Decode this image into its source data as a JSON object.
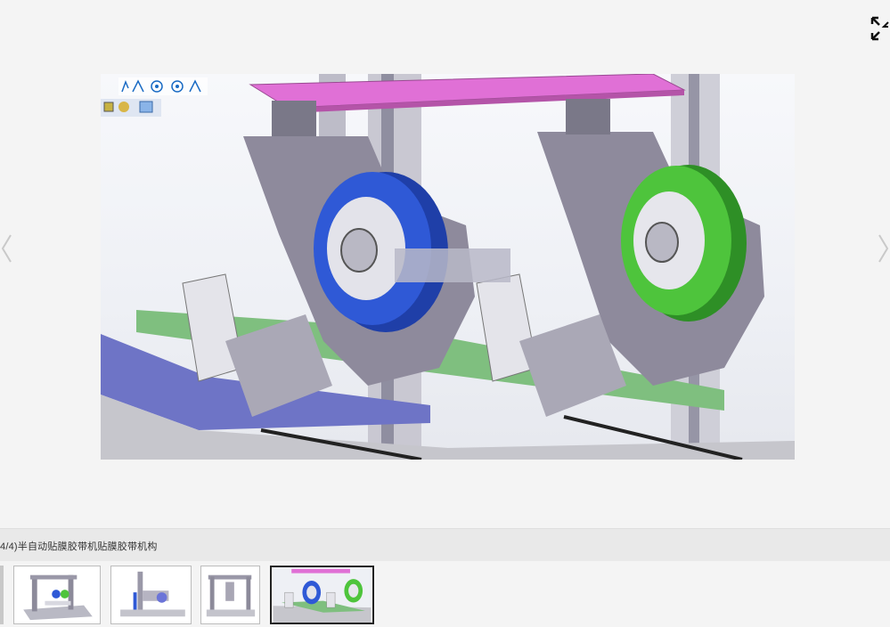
{
  "viewer": {
    "caption": "4/4)半自动贴膜胶带机贴膜胶带机构",
    "current_index": 4,
    "total": 4
  },
  "toolbar_icons": [
    "arrow-select-icon",
    "sketch-line-icon",
    "target-icon",
    "target-icon",
    "sketch-line-icon",
    "cube-icon",
    "gear-part-icon",
    "box-view-icon"
  ],
  "colors": {
    "background": "#f4f4f4",
    "caption_bar": "#e9e9e9",
    "roller_left": "#2f59d6",
    "roller_right": "#4ec43c",
    "top_plate": "#e070d6",
    "belt_green": "#7fbf7f",
    "belt_blue": "#6e74c6",
    "frame_gray": "#9a97a6"
  },
  "thumbnails": [
    {
      "index": 1,
      "label": "thumb-1"
    },
    {
      "index": 2,
      "label": "thumb-2"
    },
    {
      "index": 3,
      "label": "thumb-3"
    },
    {
      "index": 4,
      "label": "thumb-4"
    }
  ]
}
